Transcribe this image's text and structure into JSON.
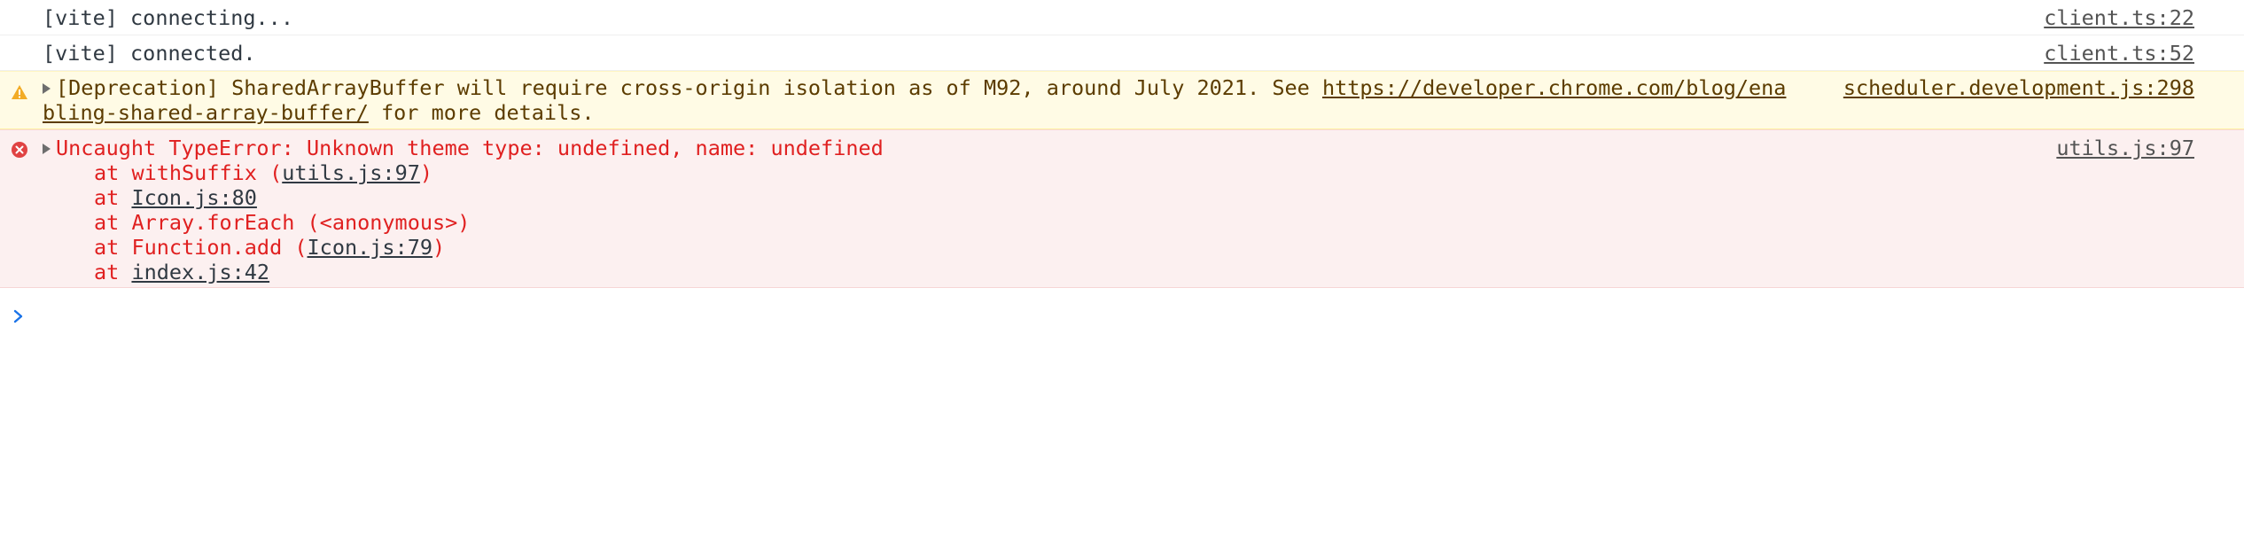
{
  "messages": {
    "log1": {
      "text": "[vite] connecting...",
      "source": "client.ts:22"
    },
    "log2": {
      "text": "[vite] connected.",
      "source": "client.ts:52"
    },
    "warning": {
      "prefix": "[Deprecation] SharedArrayBuffer will require cross-origin isolation as of M92, around July 2021. See ",
      "link_part1": "https://developer.chrome.com/blog/ena",
      "link_part2": "bling-shared-array-buffer/",
      "suffix": " for more details.",
      "source": "scheduler.development.js:298",
      "icon": "warning-triangle-icon",
      "color": "#5c3c00",
      "background": "#fffbe5"
    },
    "error": {
      "title": "Uncaught TypeError: Unknown theme type: undefined, name: undefined",
      "source": "utils.js:97",
      "icon": "error-circle-icon",
      "color": "#e02020",
      "background": "#fcf0f0",
      "stack": {
        "l1_prefix": "at withSuffix (",
        "l1_link": "utils.js:97",
        "l1_suffix": ")",
        "l2_prefix": "at ",
        "l2_link": "Icon.js:80",
        "l3_text": "at Array.forEach (<anonymous>)",
        "l4_prefix": "at Function.add (",
        "l4_link": "Icon.js:79",
        "l4_suffix": ")",
        "l5_prefix": "at ",
        "l5_link": "index.js:42"
      }
    }
  },
  "prompt": {
    "icon": "chevron-right-icon",
    "value": "",
    "placeholder": ""
  }
}
